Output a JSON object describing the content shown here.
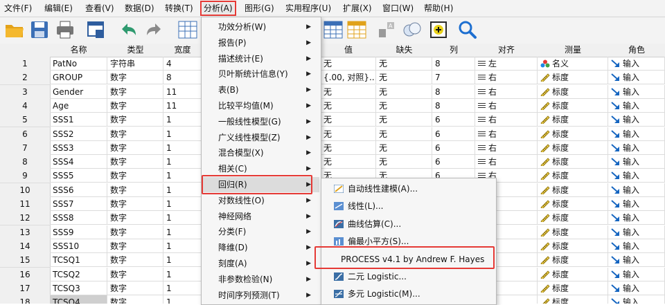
{
  "menubar": [
    "文件(F)",
    "编辑(E)",
    "查看(V)",
    "数据(D)",
    "转换(T)",
    "分析(A)",
    "图形(G)",
    "实用程序(U)",
    "扩展(X)",
    "窗口(W)",
    "帮助(H)"
  ],
  "columns": [
    "名称",
    "类型",
    "宽度",
    "值",
    "缺失",
    "列",
    "对齐",
    "测量",
    "角色"
  ],
  "rows": [
    {
      "num": "1",
      "name": "PatNo",
      "type": "字符串",
      "width": "4",
      "value": "无",
      "missing": "无",
      "cols": "8",
      "align": "左",
      "measure": "名义",
      "role": "输入"
    },
    {
      "num": "2",
      "name": "GROUP",
      "type": "数字",
      "width": "8",
      "value": "{.00, 对照}...",
      "missing": "无",
      "cols": "7",
      "align": "右",
      "measure": "标度",
      "role": "输入"
    },
    {
      "num": "3",
      "name": "Gender",
      "type": "数字",
      "width": "11",
      "value": "无",
      "missing": "无",
      "cols": "8",
      "align": "右",
      "measure": "标度",
      "role": "输入"
    },
    {
      "num": "4",
      "name": "Age",
      "type": "数字",
      "width": "11",
      "value": "无",
      "missing": "无",
      "cols": "8",
      "align": "右",
      "measure": "标度",
      "role": "输入"
    },
    {
      "num": "5",
      "name": "SSS1",
      "type": "数字",
      "width": "1",
      "value": "无",
      "missing": "无",
      "cols": "6",
      "align": "右",
      "measure": "标度",
      "role": "输入"
    },
    {
      "num": "6",
      "name": "SSS2",
      "type": "数字",
      "width": "1",
      "value": "无",
      "missing": "无",
      "cols": "6",
      "align": "右",
      "measure": "标度",
      "role": "输入"
    },
    {
      "num": "7",
      "name": "SSS3",
      "type": "数字",
      "width": "1",
      "value": "无",
      "missing": "无",
      "cols": "6",
      "align": "右",
      "measure": "标度",
      "role": "输入"
    },
    {
      "num": "8",
      "name": "SSS4",
      "type": "数字",
      "width": "1",
      "value": "无",
      "missing": "无",
      "cols": "6",
      "align": "右",
      "measure": "标度",
      "role": "输入"
    },
    {
      "num": "9",
      "name": "SSS5",
      "type": "数字",
      "width": "1",
      "value": "无",
      "missing": "无",
      "cols": "6",
      "align": "右",
      "measure": "标度",
      "role": "输入"
    },
    {
      "num": "10",
      "name": "SSS6",
      "type": "数字",
      "width": "1",
      "value": "",
      "missing": "",
      "cols": "",
      "align": "右",
      "measure": "标度",
      "role": "输入"
    },
    {
      "num": "11",
      "name": "SSS7",
      "type": "数字",
      "width": "1",
      "value": "",
      "missing": "",
      "cols": "",
      "align": "右",
      "measure": "标度",
      "role": "输入"
    },
    {
      "num": "12",
      "name": "SSS8",
      "type": "数字",
      "width": "1",
      "value": "",
      "missing": "",
      "cols": "",
      "align": "右",
      "measure": "标度",
      "role": "输入"
    },
    {
      "num": "13",
      "name": "SSS9",
      "type": "数字",
      "width": "1",
      "value": "",
      "missing": "",
      "cols": "",
      "align": "右",
      "measure": "标度",
      "role": "输入"
    },
    {
      "num": "14",
      "name": "SSS10",
      "type": "数字",
      "width": "1",
      "value": "",
      "missing": "",
      "cols": "",
      "align": "右",
      "measure": "标度",
      "role": "输入"
    },
    {
      "num": "15",
      "name": "TCSQ1",
      "type": "数字",
      "width": "1",
      "value": "",
      "missing": "",
      "cols": "",
      "align": "右",
      "measure": "标度",
      "role": "输入"
    },
    {
      "num": "16",
      "name": "TCSQ2",
      "type": "数字",
      "width": "1",
      "value": "",
      "missing": "",
      "cols": "",
      "align": "右",
      "measure": "标度",
      "role": "输入"
    },
    {
      "num": "17",
      "name": "TCSQ3",
      "type": "数字",
      "width": "1",
      "value": "",
      "missing": "",
      "cols": "",
      "align": "右",
      "measure": "标度",
      "role": "输入"
    },
    {
      "num": "18",
      "name": "TCSQ4",
      "type": "数字",
      "width": "1",
      "value": "",
      "missing": "",
      "cols": "",
      "align": "右",
      "measure": "标度",
      "role": "输入"
    }
  ],
  "analyze_menu": [
    {
      "label": "功效分析(W)",
      "arrow": true
    },
    {
      "label": "报告(P)",
      "arrow": true
    },
    {
      "label": "描述统计(E)",
      "arrow": true
    },
    {
      "label": "贝叶斯统计信息(Y)",
      "arrow": true
    },
    {
      "label": "表(B)",
      "arrow": true
    },
    {
      "label": "比较平均值(M)",
      "arrow": true
    },
    {
      "label": "一般线性模型(G)",
      "arrow": true
    },
    {
      "label": "广义线性模型(Z)",
      "arrow": true
    },
    {
      "label": "混合模型(X)",
      "arrow": true
    },
    {
      "label": "相关(C)",
      "arrow": true
    },
    {
      "label": "回归(R)",
      "arrow": true
    },
    {
      "label": "对数线性(O)",
      "arrow": true
    },
    {
      "label": "神经网络",
      "arrow": true
    },
    {
      "label": "分类(F)",
      "arrow": true
    },
    {
      "label": "降维(D)",
      "arrow": true
    },
    {
      "label": "刻度(A)",
      "arrow": true
    },
    {
      "label": "非参数检验(N)",
      "arrow": true
    },
    {
      "label": "时间序列预测(T)",
      "arrow": true
    }
  ],
  "regression_menu": [
    {
      "label": "自动线性建模(A)...",
      "icon": "auto-linear-icon"
    },
    {
      "label": "线性(L)...",
      "icon": "linear-icon"
    },
    {
      "label": "曲线估算(C)...",
      "icon": "curve-icon"
    },
    {
      "label": "偏最小平方(S)...",
      "icon": "pls-icon"
    },
    {
      "label": "PROCESS v4.1 by Andrew F. Hayes",
      "icon": ""
    },
    {
      "label": "二元 Logistic...",
      "icon": "binary-logistic-icon"
    },
    {
      "label": "多元 Logistic(M)...",
      "icon": "multinomial-logistic-icon"
    }
  ],
  "colors": {
    "highlight": "#e53935",
    "menu_bg": "#f6f6f6",
    "header_bg": "#f0f0f0"
  }
}
